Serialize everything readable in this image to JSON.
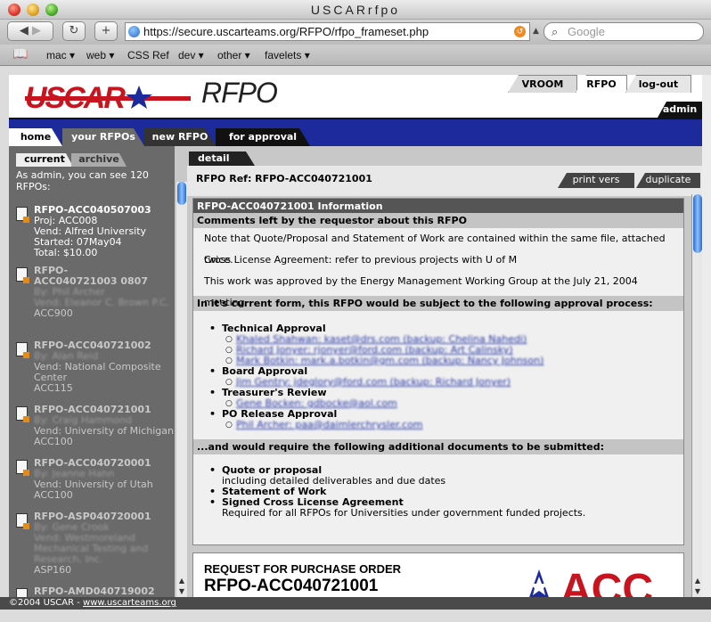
{
  "window": {
    "title": "USCARrfpo"
  },
  "browser": {
    "url": "https://secure.uscarteams.org/RFPO/rfpo_frameset.php",
    "search_placeholder": "Google",
    "bookmarks": [
      "mac ▾",
      "web ▾",
      "CSS Ref",
      "dev ▾",
      "other ▾",
      "favelets ▾"
    ]
  },
  "header": {
    "logo_text": "USCAR",
    "app_name": "RFPO",
    "tabs": [
      "VROOM",
      "RFPO",
      "log-out"
    ],
    "user": "admin"
  },
  "nav": {
    "tabs": [
      "home",
      "your RFPOs",
      "new RFPO",
      "for approval"
    ]
  },
  "sidebar": {
    "tabs": [
      "current",
      "archive"
    ],
    "note": "As admin, you can see 120 RFPOs:",
    "items": [
      {
        "ref": "RFPO-ACC040507003",
        "l1": "Proj: ACC008",
        "l2": "Vend: Alfred University",
        "l3": "Started: 07May04",
        "l4": "Total: $10.00"
      },
      {
        "ref": "RFPO-ACC040721003 0807",
        "l1": "By: Phil Archer",
        "l2": "Vend: Eleanor C. Brown P.C.",
        "l3": "ACC900"
      },
      {
        "ref": "RFPO-ACC040721002",
        "l1": "By: Alan Reid",
        "l2": "Vend: National Composite Center",
        "l3": "ACC115"
      },
      {
        "ref": "RFPO-ACC040721001",
        "l1": "By: Craig Hammond",
        "l2": "Vend: University of Michigan",
        "l3": "ACC100"
      },
      {
        "ref": "RFPO-ACC040720001",
        "l1": "By: Jeanne Hahn",
        "l2": "Vend: University of Utah",
        "l3": "ACC100"
      },
      {
        "ref": "RFPO-ASP040720001",
        "l1": "By: Gene Crook",
        "l2": "Vend: Westmoreland Mechanical Testing and Research, Inc.",
        "l3": "ASP160"
      },
      {
        "ref": "RFPO-AMD040719002",
        "l1": "",
        "l2": "",
        "l3": ""
      }
    ]
  },
  "detail": {
    "tab": "detail",
    "ref_label": "RFPO Ref: RFPO-ACC040721001",
    "buttons": [
      "print vers",
      "duplicate"
    ],
    "info_title": "RFPO-ACC040721001 Information",
    "comments_header": "Comments left by the requestor about this RFPO",
    "comments": [
      "Note that Quote/Proposal and Statement of Work are contained within the same file, attached twice.",
      "Cross License Agreement: refer to previous projects with U of M",
      "This work was approved by the Energy Management Working Group at the July 21, 2004 meeting"
    ],
    "approval_header": "In it's current form, this RFPO would be subject to the following approval process:",
    "approvals": [
      {
        "name": "Technical Approval",
        "people": [
          "Khaled Shahwan: kaset@drs.com (backup: Chelina Nahedi)",
          "Richard Jonyer: rjonyer@ford.com (backup: Art Calinsky)",
          "Mark Botkin: mark.a.botkin@gm.com (backup: Nancy Johnson)"
        ]
      },
      {
        "name": "Board Approval",
        "people": [
          "Jim Gentry: jdeglory@ford.com (backup: Richard Jonyer)"
        ]
      },
      {
        "name": "Treasurer's Review",
        "people": [
          "Gene Bocken: gdbocke@aol.com"
        ]
      },
      {
        "name": "PO Release Approval",
        "people": [
          "Phil Archer: paa@daimlerchrysler.com"
        ]
      }
    ],
    "docs_header": "...and would require the following additional documents to be submitted:",
    "docs": [
      {
        "name": "Quote or proposal",
        "desc": "including detailed deliverables and due dates"
      },
      {
        "name": "Statement of Work",
        "desc": ""
      },
      {
        "name": "Signed Cross License Agreement",
        "desc": "Required for all RFPOs for Universities under government funded projects."
      }
    ],
    "doc_title": "REQUEST FOR PURCHASE ORDER",
    "doc_ref": "RFPO-ACC040721001",
    "doc_logo": "ACC"
  },
  "footer": {
    "copyright": "©2004 USCAR - ",
    "link": "www.uscarteams.org"
  }
}
